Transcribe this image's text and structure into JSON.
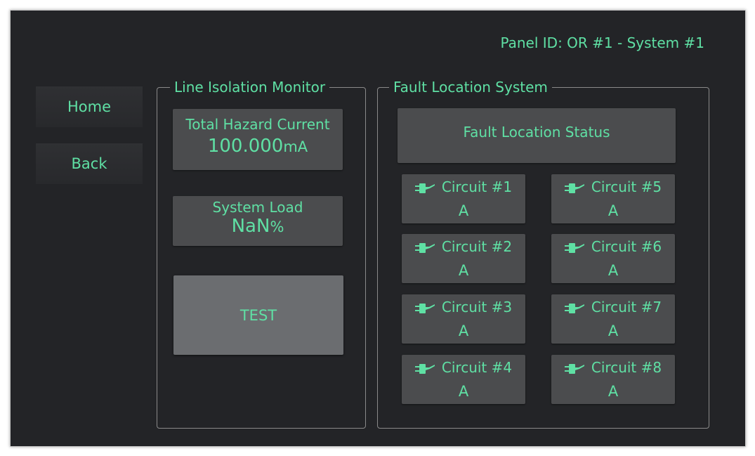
{
  "header": {
    "panel_id": "Panel ID: OR #1 - System #1"
  },
  "nav": {
    "home_label": "Home",
    "back_label": "Back"
  },
  "lim": {
    "title": "Line Isolation Monitor",
    "hazard_title": "Total Hazard Current",
    "hazard_value": "100.000",
    "hazard_unit": "mA",
    "load_title": "System Load",
    "load_value": "NaN",
    "load_unit": "%",
    "test_label": "TEST"
  },
  "fls": {
    "title": "Fault Location System",
    "status_label": "Fault Location Status",
    "circuits": [
      {
        "name": "Circuit #1",
        "value": "A"
      },
      {
        "name": "Circuit #2",
        "value": "A"
      },
      {
        "name": "Circuit #3",
        "value": "A"
      },
      {
        "name": "Circuit #4",
        "value": "A"
      },
      {
        "name": "Circuit #5",
        "value": "A"
      },
      {
        "name": "Circuit #6",
        "value": "A"
      },
      {
        "name": "Circuit #7",
        "value": "A"
      },
      {
        "name": "Circuit #8",
        "value": "A"
      }
    ]
  },
  "colors": {
    "accent": "#5fe0a4",
    "background": "#232427",
    "tile": "#4b4c4e",
    "button": "#6b6d70"
  },
  "icons": {
    "circuit_icon": "plug-icon"
  }
}
